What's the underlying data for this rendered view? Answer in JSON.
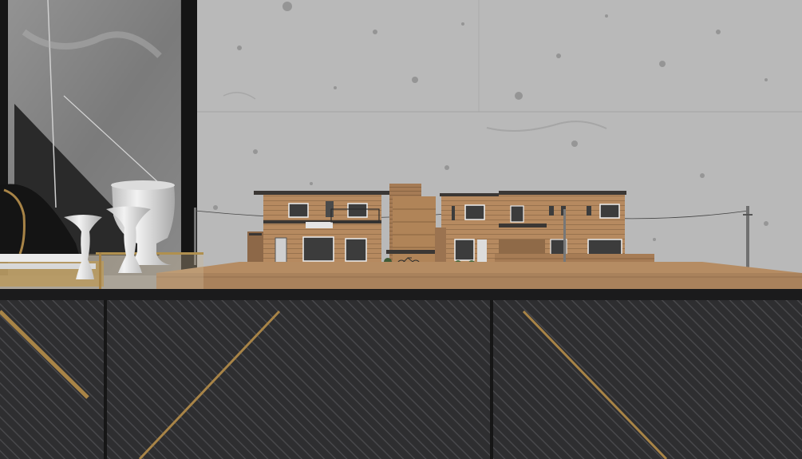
{
  "scene": {
    "title": "",
    "colors": {
      "concrete_wall": "#b8b8b8",
      "marble_panel": "#7a7a7a",
      "dark_frame": "#1a1a1a",
      "wood_board": "#a9825c",
      "wood_siding": "#b98c62",
      "roof_dark": "#3a3633",
      "cabinet": "#2b2b2d",
      "gold_trim": "#a88447",
      "vase_white": "#e6e6e6",
      "sculpture_black": "#151515"
    },
    "icons": [
      "building-model",
      "vase",
      "sculpture",
      "cabinet",
      "utility-pole",
      "bicycle",
      "potted-plant"
    ]
  }
}
